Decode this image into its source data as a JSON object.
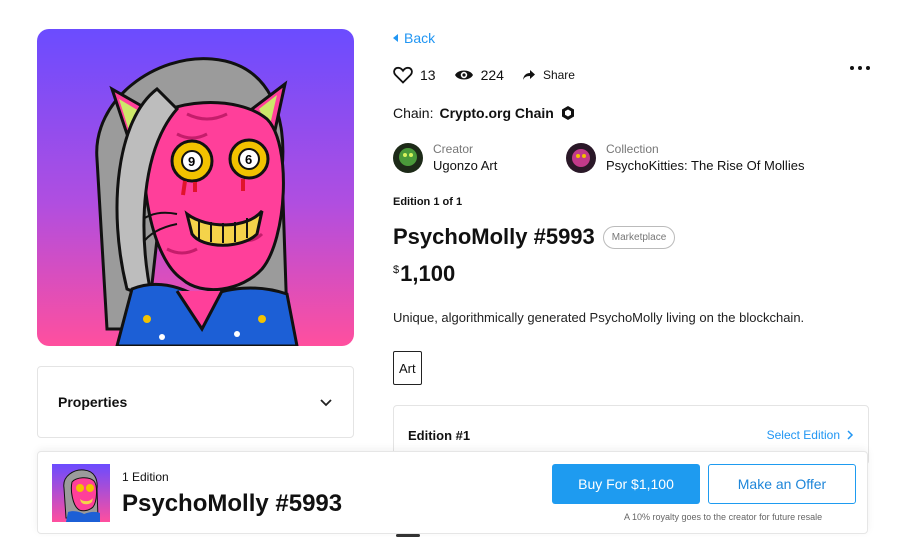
{
  "nav": {
    "back_label": "Back"
  },
  "stats": {
    "likes": "13",
    "views": "224",
    "share_label": "Share"
  },
  "chain": {
    "label": "Chain:",
    "value": "Crypto.org Chain"
  },
  "creator": {
    "label": "Creator",
    "name": "Ugonzo Art"
  },
  "collection": {
    "label": "Collection",
    "name": "PsychoKitties: The Rise Of Mollies"
  },
  "nft": {
    "edition_text": "Edition 1 of 1",
    "title": "PsychoMolly #5993",
    "badge": "Marketplace",
    "currency": "$",
    "price": "1,100",
    "description": "Unique, algorithmically generated PsychoMolly living on the blockchain.",
    "tag": "Art"
  },
  "properties": {
    "label": "Properties"
  },
  "edition_select": {
    "label": "Edition #1",
    "action": "Select Edition"
  },
  "bottom_bar": {
    "edition_count": "1 Edition",
    "title": "PsychoMolly #5993",
    "buy_label": "Buy For $1,100",
    "offer_label": "Make an Offer",
    "royalty_note": "A 10% royalty goes to the creator for future resale"
  },
  "colors": {
    "accent": "#1e9bf0",
    "art_top": "#7a4dff",
    "art_bottom": "#ff4fa3",
    "cat_pink": "#ff3f9a"
  },
  "icons": {
    "back": "caret-left-icon",
    "like": "heart-icon",
    "views": "eye-icon",
    "share": "share-icon",
    "more": "more-dots-icon",
    "chain": "chain-hexagon-icon",
    "expand": "chevron-down-icon",
    "select": "chevron-right-icon"
  }
}
